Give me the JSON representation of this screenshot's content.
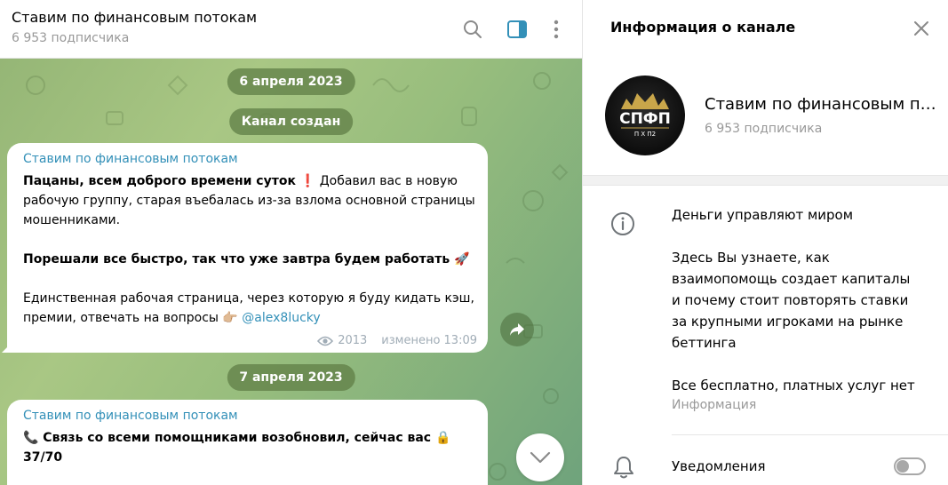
{
  "chat": {
    "title": "Ставим по финансовым потокам",
    "subscribers": "6 953 подписчика"
  },
  "messages": [
    {
      "date": "6 апреля 2023",
      "service": "Канал создан",
      "author": "Ставим по финансовым потокам",
      "bold_text": "Пацаны, всем доброго времени суток ❗",
      "text_1": " Добавил вас в новую рабочую группу, старая въебалась из-за взлома основной страницы мошенниками.",
      "bold_text_2": "Порешали все быстро, так что уже завтра будем работать 🚀",
      "text_2": "Единственная рабочая страница, через которую я буду кидать кэш, премии, отвечать на вопросы 👉🏼 ",
      "mention": "@alex8lucky",
      "views": "2013",
      "edited": "изменено 13:09"
    },
    {
      "date": "7 апреля 2023",
      "author": "Ставим по финансовым потокам",
      "bold_text": "📞 Связь со всеми помощниками возобновил, сейчас вас 🔒 37/70"
    }
  ],
  "info_panel": {
    "title": "Информация о канале",
    "channel_name": "Ставим по финансовым потокам",
    "subscribers": "6 953 подписчика",
    "avatar_text": "СПФП",
    "avatar_subtext": "П Х П2",
    "description_lines": [
      "Деньги управляют миром",
      "Здесь Вы узнаете, как взаимопомощь создает капиталы и почему стоит повторять ставки за крупными игроками на рынке беттинга",
      "Все бесплатно, платных услуг нет"
    ],
    "description_label": "Информация",
    "notifications_label": "Уведомления",
    "notifications_on": false
  },
  "colors": {
    "accent": "#3390b8",
    "date_pill": "#628048",
    "muted": "#999999"
  },
  "icons": {
    "search": "search-icon",
    "sidebar": "sidebar-toggle-icon",
    "more": "more-vertical-icon",
    "close": "close-icon",
    "share": "share-icon",
    "scroll_down": "chevron-down-icon",
    "info": "info-icon",
    "bell": "bell-icon",
    "views": "eye-icon"
  }
}
